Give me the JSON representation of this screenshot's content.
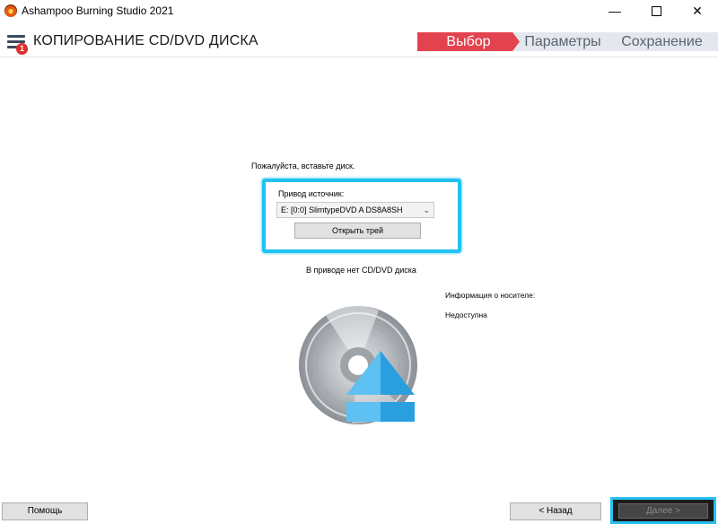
{
  "window": {
    "title": "Ashampoo Burning Studio 2021",
    "min_glyph": "—",
    "close_glyph": "✕"
  },
  "header": {
    "title": "КОПИРОВАНИЕ CD/DVD ДИСКА",
    "notification_count": "1",
    "steps": [
      {
        "label": "Выбор",
        "active": true
      },
      {
        "label": "Параметры",
        "active": false
      },
      {
        "label": "Сохранение",
        "active": false
      }
    ]
  },
  "content": {
    "insert_hint": "Пожалуйста, вставьте диск.",
    "source_label": "Привод источник:",
    "drive_selected": "E: [0:0] SlimtypeDVD A DS8A8SH",
    "open_tray_label": "Открыть трей",
    "no_disc_text": "В приводе нет CD/DVD диска",
    "media_info_label": "Информация о носителе:",
    "media_info_value": "Недоступна"
  },
  "footer": {
    "help_label": "Помощь",
    "back_label": "< Назад",
    "next_label": "Далее >"
  },
  "colors": {
    "accent_active_step": "#e3434f",
    "highlight": "#23c1f2",
    "eject_blue": "#2a9fe0"
  },
  "icons": [
    "app-icon",
    "hamburger-menu-icon",
    "disc-eject-icon",
    "chevron-down-icon"
  ]
}
